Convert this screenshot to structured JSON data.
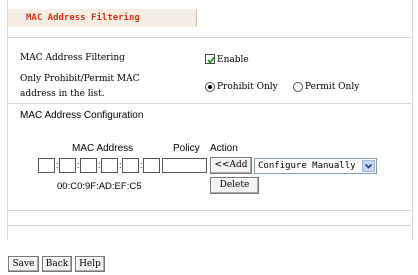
{
  "title": "MAC Address Filtering",
  "filtering": {
    "label": "MAC Address Filtering",
    "enable_label": "Enable",
    "enabled": true
  },
  "mode": {
    "label_line1": "Only Prohibit/Permit MAC",
    "label_line2": "address in the list.",
    "prohibit_label": "Prohibit Only",
    "permit_label": "Permit Only",
    "selected": "Prohibit Only"
  },
  "config": {
    "heading": "MAC Address Configuration",
    "col_mac": "MAC Address",
    "col_policy": "Policy",
    "col_action": "Action",
    "add_label": "<<Add",
    "select_value": "Configure Manually",
    "entries": [
      {
        "mac": "00:C0:9F:AD:EF:C5",
        "delete_label": "Delete"
      }
    ]
  },
  "buttons": {
    "save": "Save",
    "back": "Back",
    "help": "Help"
  },
  "colors": {
    "title": "#d2331c",
    "title_bg": "#f3ede4",
    "select_border": "#7f9db9"
  }
}
